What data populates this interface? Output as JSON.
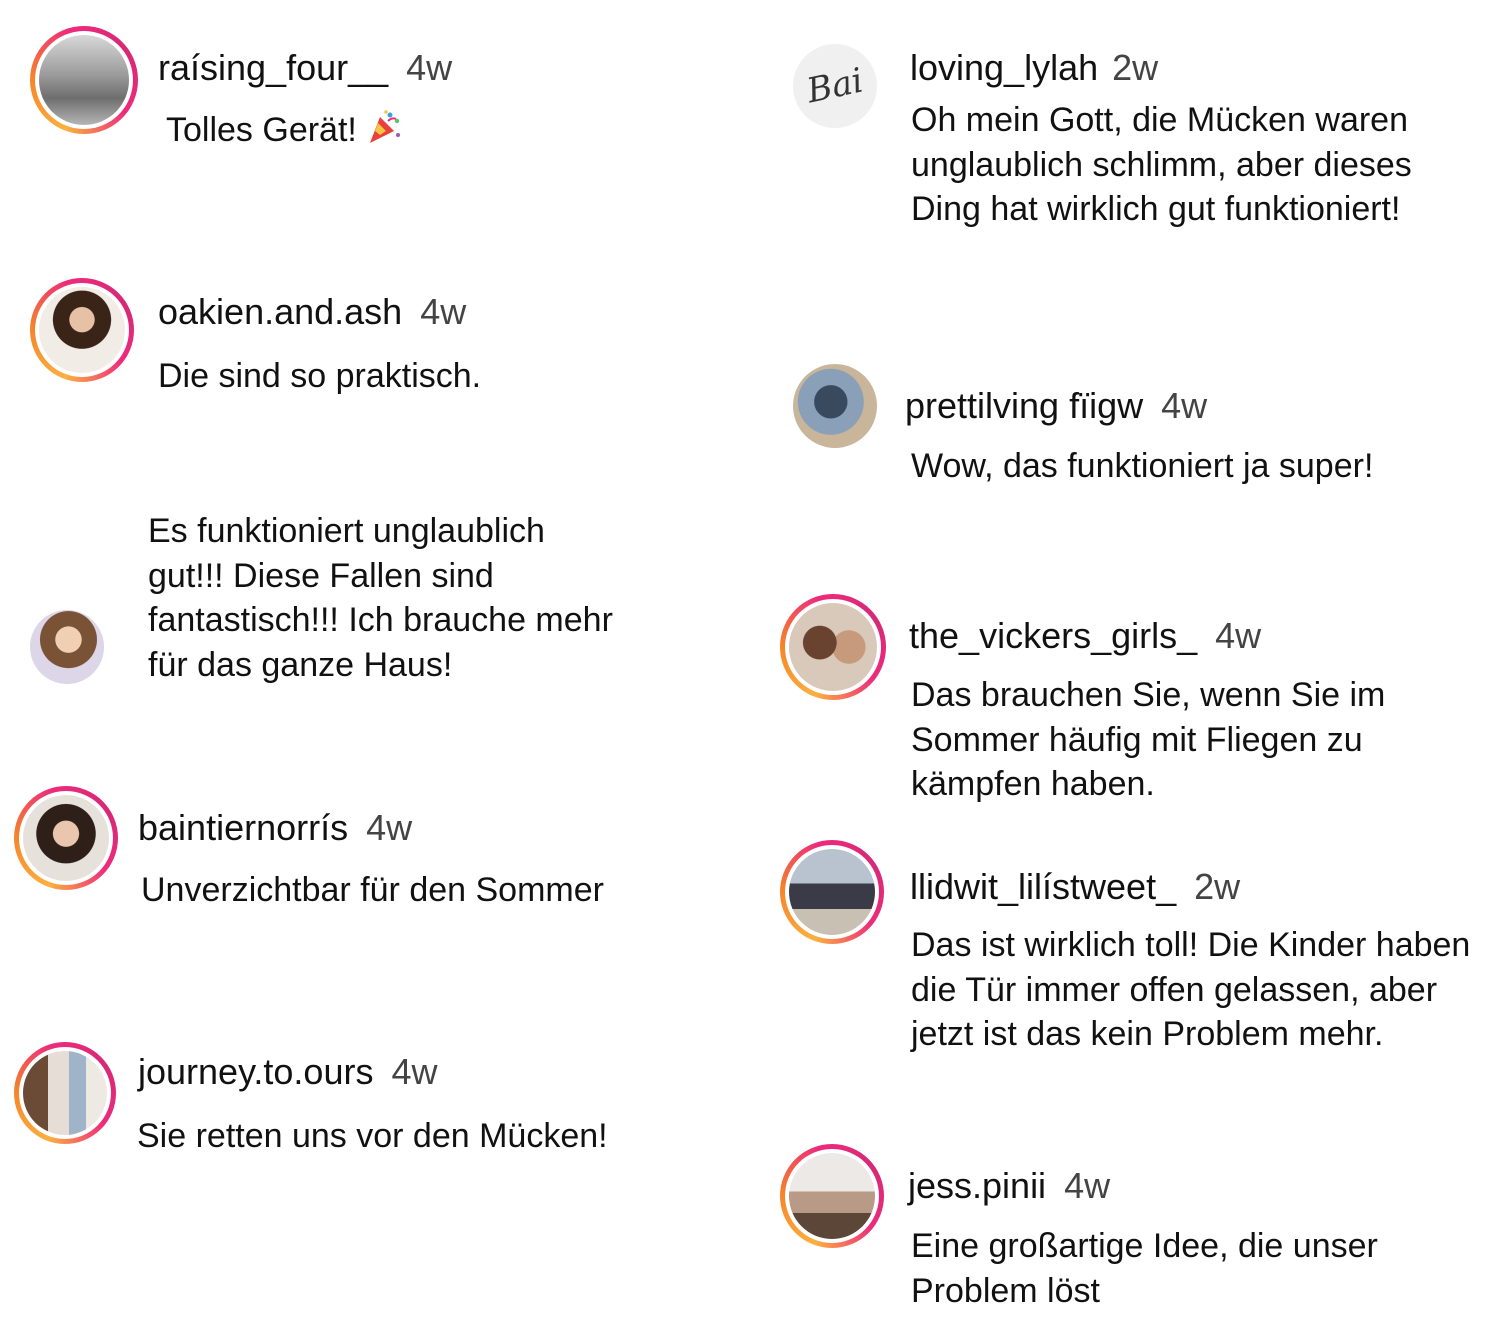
{
  "comments": [
    {
      "user": "raísing_four__",
      "time": "4w",
      "text": "Tolles Gerät!",
      "emoji": "party-popper-icon"
    },
    {
      "user": "oakien.and.ash",
      "time": "4w",
      "text": "Die sind so praktisch."
    },
    {
      "user": "",
      "time": "",
      "text": "Es funktioniert unglaublich gut!!! Diese Fallen sind fantastisch!!! Ich brauche mehr für das ganze Haus!"
    },
    {
      "user": "baintiernorrís",
      "time": "4w",
      "text": "Unverzichtbar für den Sommer"
    },
    {
      "user": "journey.to.ours",
      "time": "4w",
      "text": "Sie retten uns vor den Mücken!"
    },
    {
      "user": "loving_lylah",
      "time": "2w",
      "text": "Oh mein Gott, die Mücken waren unglaublich schlimm, aber dieses Ding hat wirklich gut funktioniert!",
      "avatar_text": "Bai"
    },
    {
      "user": "prettilving fïigw",
      "time": "4w",
      "text": "Wow, das funktioniert ja super!"
    },
    {
      "user": "the_vickers_girls_",
      "time": "4w",
      "text": "Das brauchen Sie, wenn Sie im Sommer häufig mit Fliegen zu kämpfen haben."
    },
    {
      "user": "llidwit_lilístweet_",
      "time": "2w",
      "text": "Das ist wirklich toll! Die Kinder haben die Tür immer offen gelassen, aber jetzt ist das kein Problem mehr."
    },
    {
      "user": "jess.pinii",
      "time": "4w",
      "text": "Eine großartige Idee, die unser Problem löst"
    }
  ],
  "colors": {
    "ring_start": "#fbb040",
    "ring_mid": "#ee2a7b",
    "text": "#111111",
    "time": "#444444"
  }
}
